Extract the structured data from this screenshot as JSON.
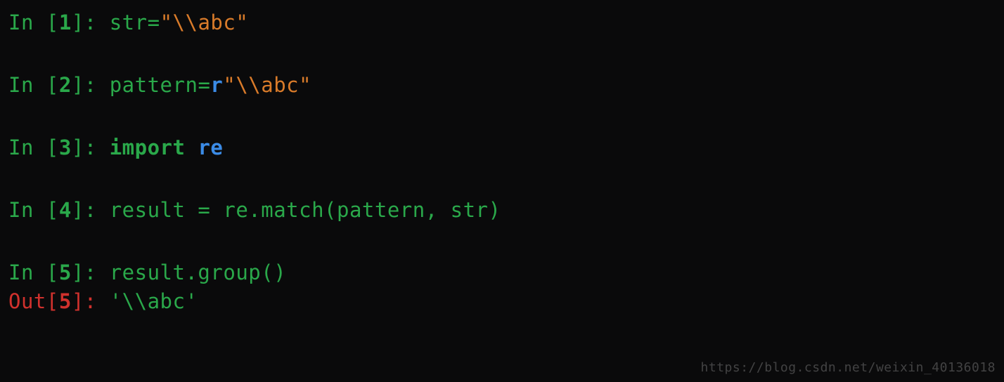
{
  "cells": [
    {
      "kind": "in",
      "n": "1",
      "segments": [
        {
          "cls": "green",
          "bind": "code.c1.s0",
          "text": "str"
        },
        {
          "cls": "green",
          "bind": "code.c1.s1",
          "text": "="
        },
        {
          "cls": "orange",
          "bind": "code.c1.s2",
          "text": "\"\\\\abc\""
        }
      ]
    },
    {
      "kind": "in",
      "n": "2",
      "segments": [
        {
          "cls": "green",
          "bind": "code.c2.s0",
          "text": "pattern"
        },
        {
          "cls": "green",
          "bind": "code.c2.s1",
          "text": "="
        },
        {
          "cls": "blue",
          "bind": "code.c2.s2",
          "text": "r"
        },
        {
          "cls": "orange",
          "bind": "code.c2.s3",
          "text": "\"\\\\abc\""
        }
      ]
    },
    {
      "kind": "in",
      "n": "3",
      "segments": [
        {
          "cls": "keyword",
          "bind": "code.c3.s0",
          "text": "import"
        },
        {
          "cls": "",
          "bind": "code.c3.s1",
          "text": " "
        },
        {
          "cls": "blue",
          "bind": "code.c3.s2",
          "text": "re"
        }
      ]
    },
    {
      "kind": "in",
      "n": "4",
      "segments": [
        {
          "cls": "green",
          "bind": "code.c4.s0",
          "text": "result = re.match(pattern, str)"
        }
      ]
    },
    {
      "kind": "in",
      "n": "5",
      "segments": [
        {
          "cls": "green",
          "bind": "code.c5.s0",
          "text": "result.group()"
        }
      ],
      "nogap": true
    },
    {
      "kind": "out",
      "n": "5",
      "segments": [
        {
          "cls": "green",
          "bind": "code.o5.s0",
          "text": "'\\\\abc'"
        }
      ]
    }
  ],
  "code": {
    "c1": {
      "s0": "str",
      "s1": "=",
      "s2": "\"\\\\abc\""
    },
    "c2": {
      "s0": "pattern",
      "s1": "=",
      "s2": "r",
      "s3": "\"\\\\abc\""
    },
    "c3": {
      "s0": "import",
      "s1": " ",
      "s2": "re"
    },
    "c4": {
      "s0": "result = re.match(pattern, str)"
    },
    "c5": {
      "s0": "result.group()"
    },
    "o5": {
      "s0": "'\\\\abc'"
    }
  },
  "labels": {
    "in": "In ",
    "out": "Out",
    "open": "[",
    "close": "]: "
  },
  "watermark": "https://blog.csdn.net/weixin_40136018"
}
